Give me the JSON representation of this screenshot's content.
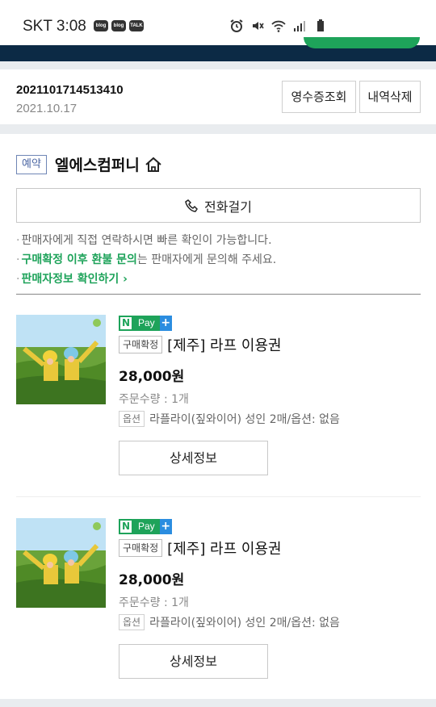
{
  "status_bar": {
    "carrier_time": "SKT 3:08",
    "notifications": [
      "blog",
      "blog",
      "TALK"
    ]
  },
  "order": {
    "number": "2021101714513410",
    "date": "2021.10.17",
    "receipt_button": "영수증조회",
    "delete_button": "내역삭제"
  },
  "seller": {
    "badge": "예약",
    "name": "엘에스컴퍼니",
    "call_button": "전화걸기"
  },
  "notes": {
    "line1": "판매자에게 직접 연락하시면 빠른 확인이 가능합니다.",
    "line2_highlight": "구매확정 이후 환불 문의",
    "line2_rest": "는 판매자에게 문의해 주세요.",
    "line3_link": "판매자정보 확인하기"
  },
  "products": [
    {
      "npay_n": "N",
      "npay_label": "Pay",
      "npay_plus": "+",
      "status": "구매확정",
      "title": "[제주] 라프 이용권",
      "price": "28,000원",
      "quantity": "주문수량 : 1개",
      "option_tag": "옵션",
      "option_text": "라플라이(짚와이어) 성인 2매/옵션: 없음",
      "detail_button": "상세정보"
    },
    {
      "npay_n": "N",
      "npay_label": "Pay",
      "npay_plus": "+",
      "status": "구매확정",
      "title": "[제주] 라프 이용권",
      "price": "28,000원",
      "quantity": "주문수량 : 1개",
      "option_tag": "옵션",
      "option_text": "라플라이(짚와이어) 성인 2매/옵션: 없음",
      "detail_button": "상세정보"
    }
  ],
  "colors": {
    "accent_green": "#1ea35a",
    "navy": "#0c2a45",
    "badge_blue": "#4b66a3"
  }
}
